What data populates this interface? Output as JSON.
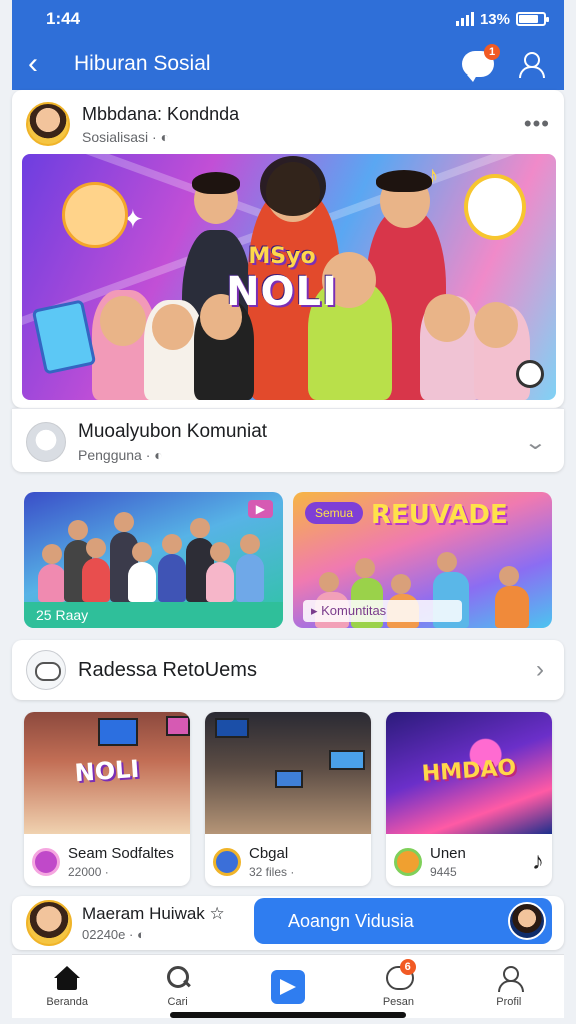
{
  "status": {
    "time": "1:44",
    "battery": "13%"
  },
  "appbar": {
    "title": "Hiburan Sosial",
    "chat_badge": "1"
  },
  "post": {
    "author": "Mbbdana: Kondnda",
    "meta": "Sosialisasi ·",
    "hero_title_top": "MSyo",
    "hero_title_main": "NOLI"
  },
  "community": {
    "name": "Muoalyubon Komuniat",
    "sub": "Pengguna ·"
  },
  "tiles": [
    {
      "caption": "25 Raay"
    },
    {
      "pill": "Semua",
      "banner": "REUVADE",
      "caption": "Komuntitas"
    }
  ],
  "reco": {
    "title": "Radessa RetoUems"
  },
  "videos": [
    {
      "title": "Seam Sodfaltes",
      "sub": "22000 ·",
      "thumb_label": "NOLI",
      "dot_color": "#c049c9"
    },
    {
      "title": "Cbgal",
      "sub": "32 files ·",
      "thumb_label": "",
      "dot_color": "#3b6fd9"
    },
    {
      "title": "Unen",
      "sub": "9445",
      "thumb_label": "HMDAO",
      "dot_color": "#f0a030"
    }
  ],
  "compose": {
    "name": "Maeram Huiwak ☆",
    "sub": "02240e ·",
    "cta": "Aoangn Vidusia"
  },
  "tabs": [
    {
      "label": "Beranda",
      "icon": "home-icon"
    },
    {
      "label": "Cari",
      "icon": "search-icon"
    },
    {
      "label": "",
      "icon": "send-icon"
    },
    {
      "label": "Pesan",
      "icon": "message-icon",
      "badge": "6"
    },
    {
      "label": "Profil",
      "icon": "user-icon"
    }
  ],
  "colors": {
    "brand": "#2f6fd8",
    "accent": "#2f7df0",
    "badge": "#f15a24"
  }
}
